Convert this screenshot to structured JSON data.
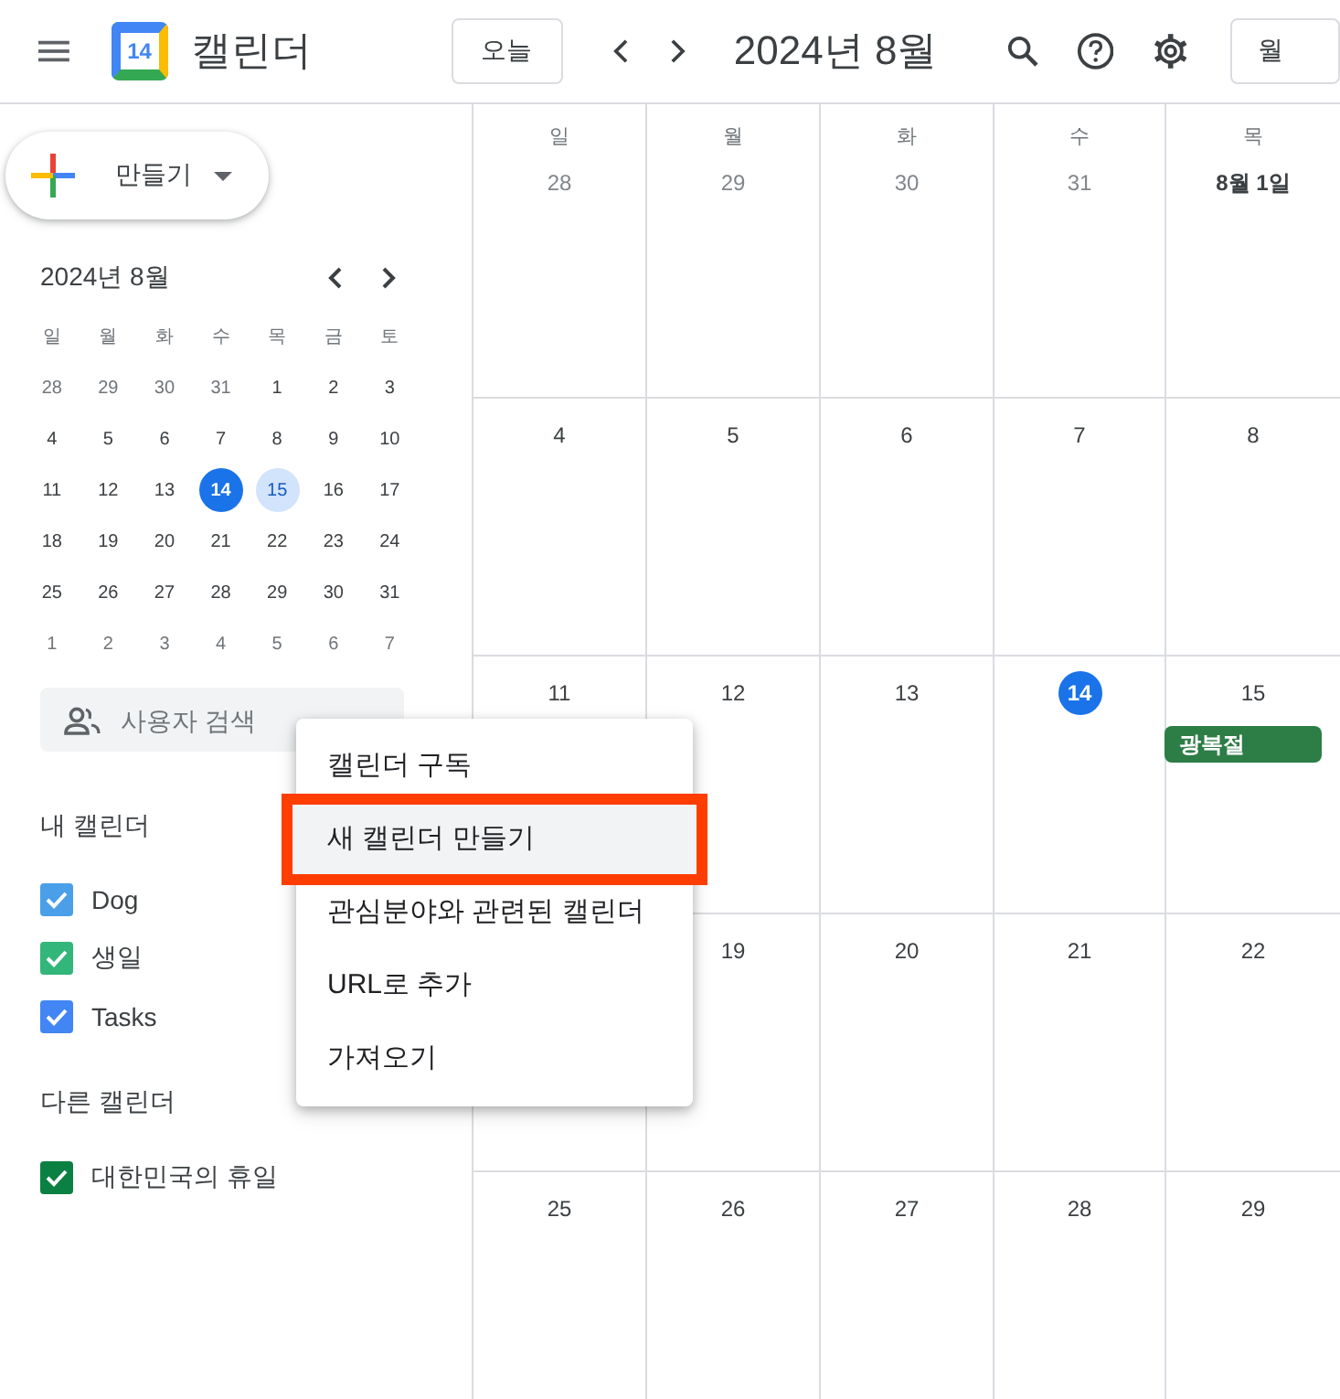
{
  "header": {
    "app_name": "캘린더",
    "logo_day": "14",
    "today_button": "오늘",
    "period": "2024년 8월",
    "view_button": "월"
  },
  "create_button": {
    "label": "만들기"
  },
  "mini_calendar": {
    "title": "2024년 8월",
    "weekdays": [
      "일",
      "월",
      "화",
      "수",
      "목",
      "금",
      "토"
    ],
    "days": [
      {
        "d": "28",
        "muted": true,
        "today": false,
        "selected": false
      },
      {
        "d": "29",
        "muted": true,
        "today": false,
        "selected": false
      },
      {
        "d": "30",
        "muted": true,
        "today": false,
        "selected": false
      },
      {
        "d": "31",
        "muted": true,
        "today": false,
        "selected": false
      },
      {
        "d": "1",
        "muted": false,
        "today": false,
        "selected": false
      },
      {
        "d": "2",
        "muted": false,
        "today": false,
        "selected": false
      },
      {
        "d": "3",
        "muted": false,
        "today": false,
        "selected": false
      },
      {
        "d": "4",
        "muted": false,
        "today": false,
        "selected": false
      },
      {
        "d": "5",
        "muted": false,
        "today": false,
        "selected": false
      },
      {
        "d": "6",
        "muted": false,
        "today": false,
        "selected": false
      },
      {
        "d": "7",
        "muted": false,
        "today": false,
        "selected": false
      },
      {
        "d": "8",
        "muted": false,
        "today": false,
        "selected": false
      },
      {
        "d": "9",
        "muted": false,
        "today": false,
        "selected": false
      },
      {
        "d": "10",
        "muted": false,
        "today": false,
        "selected": false
      },
      {
        "d": "11",
        "muted": false,
        "today": false,
        "selected": false
      },
      {
        "d": "12",
        "muted": false,
        "today": false,
        "selected": false
      },
      {
        "d": "13",
        "muted": false,
        "today": false,
        "selected": false
      },
      {
        "d": "14",
        "muted": false,
        "today": true,
        "selected": false
      },
      {
        "d": "15",
        "muted": false,
        "today": false,
        "selected": true
      },
      {
        "d": "16",
        "muted": false,
        "today": false,
        "selected": false
      },
      {
        "d": "17",
        "muted": false,
        "today": false,
        "selected": false
      },
      {
        "d": "18",
        "muted": false,
        "today": false,
        "selected": false
      },
      {
        "d": "19",
        "muted": false,
        "today": false,
        "selected": false
      },
      {
        "d": "20",
        "muted": false,
        "today": false,
        "selected": false
      },
      {
        "d": "21",
        "muted": false,
        "today": false,
        "selected": false
      },
      {
        "d": "22",
        "muted": false,
        "today": false,
        "selected": false
      },
      {
        "d": "23",
        "muted": false,
        "today": false,
        "selected": false
      },
      {
        "d": "24",
        "muted": false,
        "today": false,
        "selected": false
      },
      {
        "d": "25",
        "muted": false,
        "today": false,
        "selected": false
      },
      {
        "d": "26",
        "muted": false,
        "today": false,
        "selected": false
      },
      {
        "d": "27",
        "muted": false,
        "today": false,
        "selected": false
      },
      {
        "d": "28",
        "muted": false,
        "today": false,
        "selected": false
      },
      {
        "d": "29",
        "muted": false,
        "today": false,
        "selected": false
      },
      {
        "d": "30",
        "muted": false,
        "today": false,
        "selected": false
      },
      {
        "d": "31",
        "muted": false,
        "today": false,
        "selected": false
      },
      {
        "d": "1",
        "muted": true,
        "today": false,
        "selected": false
      },
      {
        "d": "2",
        "muted": true,
        "today": false,
        "selected": false
      },
      {
        "d": "3",
        "muted": true,
        "today": false,
        "selected": false
      },
      {
        "d": "4",
        "muted": true,
        "today": false,
        "selected": false
      },
      {
        "d": "5",
        "muted": true,
        "today": false,
        "selected": false
      },
      {
        "d": "6",
        "muted": true,
        "today": false,
        "selected": false
      },
      {
        "d": "7",
        "muted": true,
        "today": false,
        "selected": false
      }
    ]
  },
  "people_search": {
    "placeholder": "사용자 검색"
  },
  "calendar_groups": [
    {
      "title": "내 캘린더",
      "items": [
        {
          "name": "Dog",
          "checked": true,
          "color": "#4a9fe8"
        },
        {
          "name": "생일",
          "checked": true,
          "color": "#33b679"
        },
        {
          "name": "Tasks",
          "checked": true,
          "color": "#4285f4"
        }
      ]
    },
    {
      "title": "다른 캘린더",
      "items": [
        {
          "name": "대한민국의 휴일",
          "checked": true,
          "color": "#0b8043"
        }
      ]
    }
  ],
  "month": {
    "weekdays": [
      "일",
      "월",
      "화",
      "수",
      "목"
    ],
    "days": [
      {
        "kind": "day",
        "date": "28",
        "muted": true,
        "today": false,
        "first": false
      },
      {
        "kind": "day",
        "date": "29",
        "muted": true,
        "today": false,
        "first": false
      },
      {
        "kind": "day",
        "date": "30",
        "muted": true,
        "today": false,
        "first": false
      },
      {
        "kind": "day",
        "date": "31",
        "muted": true,
        "today": false,
        "first": false
      },
      {
        "kind": "day",
        "date": "8월 1일",
        "muted": false,
        "today": false,
        "first": true
      },
      {
        "kind": "day",
        "date": "4",
        "muted": false,
        "today": false,
        "first": false
      },
      {
        "kind": "day",
        "date": "5",
        "muted": false,
        "today": false,
        "first": false
      },
      {
        "kind": "day",
        "date": "6",
        "muted": false,
        "today": false,
        "first": false
      },
      {
        "kind": "day",
        "date": "7",
        "muted": false,
        "today": false,
        "first": false
      },
      {
        "kind": "day",
        "date": "8",
        "muted": false,
        "today": false,
        "first": false
      },
      {
        "kind": "day",
        "date": "11",
        "muted": false,
        "today": false,
        "first": false
      },
      {
        "kind": "day",
        "date": "12",
        "muted": false,
        "today": false,
        "first": false
      },
      {
        "kind": "day",
        "date": "13",
        "muted": false,
        "today": false,
        "first": false
      },
      {
        "kind": "day",
        "date": "14",
        "muted": false,
        "today": true,
        "first": false
      },
      {
        "kind": "day",
        "date": "15",
        "muted": false,
        "today": false,
        "first": false,
        "events": [
          {
            "title": "광복절",
            "color": "#2d7d46"
          }
        ]
      },
      {
        "kind": "covered"
      },
      {
        "kind": "day",
        "date": "19",
        "muted": false,
        "today": false,
        "first": false
      },
      {
        "kind": "day",
        "date": "20",
        "muted": false,
        "today": false,
        "first": false
      },
      {
        "kind": "day",
        "date": "21",
        "muted": false,
        "today": false,
        "first": false
      },
      {
        "kind": "day",
        "date": "22",
        "muted": false,
        "today": false,
        "first": false
      },
      {
        "kind": "day",
        "date": "25",
        "muted": false,
        "today": false,
        "first": false
      },
      {
        "kind": "day",
        "date": "26",
        "muted": false,
        "today": false,
        "first": false
      },
      {
        "kind": "day",
        "date": "27",
        "muted": false,
        "today": false,
        "first": false
      },
      {
        "kind": "day",
        "date": "28",
        "muted": false,
        "today": false,
        "first": false
      },
      {
        "kind": "day",
        "date": "29",
        "muted": false,
        "today": false,
        "first": false
      }
    ]
  },
  "menu": {
    "items": [
      {
        "label": "캘린더 구독",
        "hovered": false,
        "highlighted": false
      },
      {
        "label": "새 캘린더 만들기",
        "hovered": true,
        "highlighted": true
      },
      {
        "label": "관심분야와 관련된 캘린더",
        "hovered": false,
        "highlighted": false
      },
      {
        "label": "URL로 추가",
        "hovered": false,
        "highlighted": false
      },
      {
        "label": "가져오기",
        "hovered": false,
        "highlighted": false
      }
    ]
  }
}
